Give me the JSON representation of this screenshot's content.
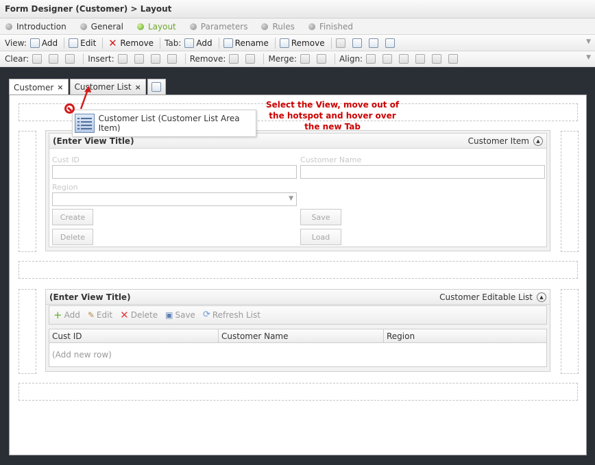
{
  "title": "Form Designer (Customer) > Layout",
  "wizard_steps": [
    {
      "label": "Introduction",
      "state": "done"
    },
    {
      "label": "General",
      "state": "done"
    },
    {
      "label": "Layout",
      "state": "active"
    },
    {
      "label": "Parameters",
      "state": "pending"
    },
    {
      "label": "Rules",
      "state": "pending"
    },
    {
      "label": "Finished",
      "state": "pending"
    }
  ],
  "toolbar1": {
    "view_label": "View:",
    "view_add": "Add",
    "view_edit": "Edit",
    "view_remove": "Remove",
    "tab_label": "Tab:",
    "tab_add": "Add",
    "tab_rename": "Rename",
    "tab_remove": "Remove"
  },
  "toolbar2": {
    "clear_label": "Clear:",
    "insert_label": "Insert:",
    "remove_label": "Remove:",
    "merge_label": "Merge:",
    "align_label": "Align:"
  },
  "tabs": [
    {
      "label": "Customer",
      "close": "×"
    },
    {
      "label": "Customer List",
      "close": "×"
    }
  ],
  "drag_popup": {
    "text": "Customer List (Customer List Area Item)"
  },
  "callout": "Select the View, move out of the hotspot and hover over the new Tab",
  "view1": {
    "title": "(Enter View Title)",
    "name": "Customer Item",
    "fields": {
      "cust_id": "Cust ID",
      "customer_name": "Customer Name",
      "region": "Region"
    },
    "buttons": {
      "create": "Create",
      "save": "Save",
      "delete": "Delete",
      "load": "Load"
    }
  },
  "view2": {
    "title": "(Enter View Title)",
    "name": "Customer Editable List",
    "toolbar": {
      "add": "Add",
      "edit": "Edit",
      "delete": "Delete",
      "save": "Save",
      "refresh": "Refresh List"
    },
    "columns": [
      "Cust ID",
      "Customer Name",
      "Region"
    ],
    "new_row": "(Add new row)"
  },
  "colors": {
    "accent": "#6ba52a",
    "callout": "#cc0000",
    "background": "#2a2f36"
  }
}
